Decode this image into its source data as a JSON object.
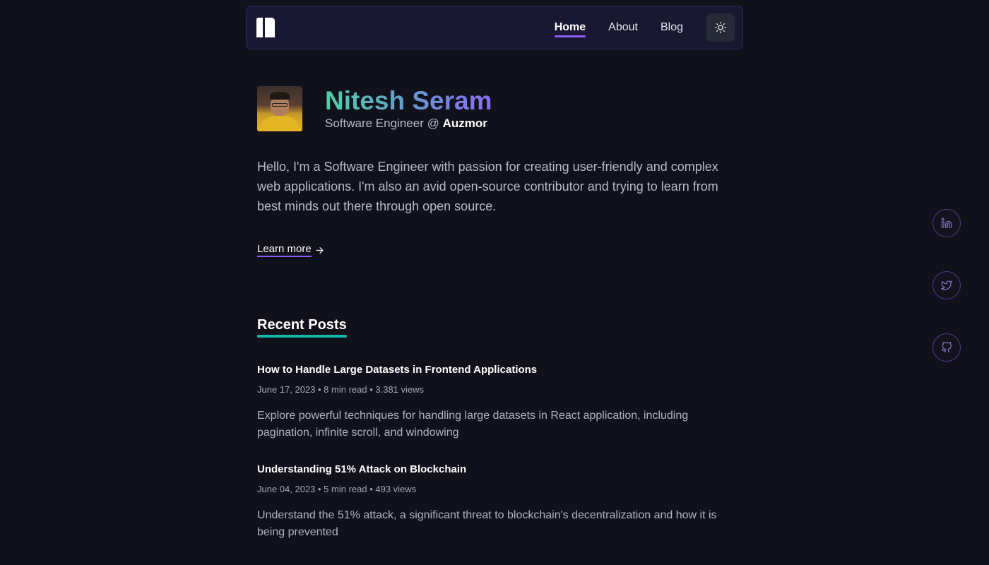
{
  "nav": {
    "links": [
      {
        "label": "Home",
        "active": true
      },
      {
        "label": "About",
        "active": false
      },
      {
        "label": "Blog",
        "active": false
      }
    ],
    "theme_toggle_icon": "sun-icon",
    "logo_icon": "site-logo-icon"
  },
  "profile": {
    "name": "Nitesh Seram",
    "role_prefix": "Software Engineer @",
    "company": "Auzmor",
    "bio": "Hello, I'm a Software Engineer with passion for creating user-friendly and complex web applications. I'm also an avid open-source contributor and trying to learn from best minds out there through open source.",
    "learn_more": "Learn more",
    "learn_more_icon": "arrow-right-icon"
  },
  "recent_posts": {
    "title": "Recent Posts",
    "posts": [
      {
        "title": "How to Handle Large Datasets in Frontend Applications",
        "meta": "June 17, 2023 • 8 min read • 3.381 views",
        "description": "Explore powerful techniques for handling large datasets in React application, including pagination, infinite scroll, and windowing"
      },
      {
        "title": "Understanding 51% Attack on Blockchain",
        "meta": "June 04, 2023 • 5 min read • 493 views",
        "description": "Understand the 51% attack, a significant threat to blockchain's decentralization and how it is being prevented"
      }
    ]
  },
  "socials": [
    "linkedin-icon",
    "twitter-icon",
    "github-icon"
  ],
  "colors": {
    "background": "#11111b",
    "accent": "#8b5cf6",
    "teal": "#14b8a6"
  }
}
